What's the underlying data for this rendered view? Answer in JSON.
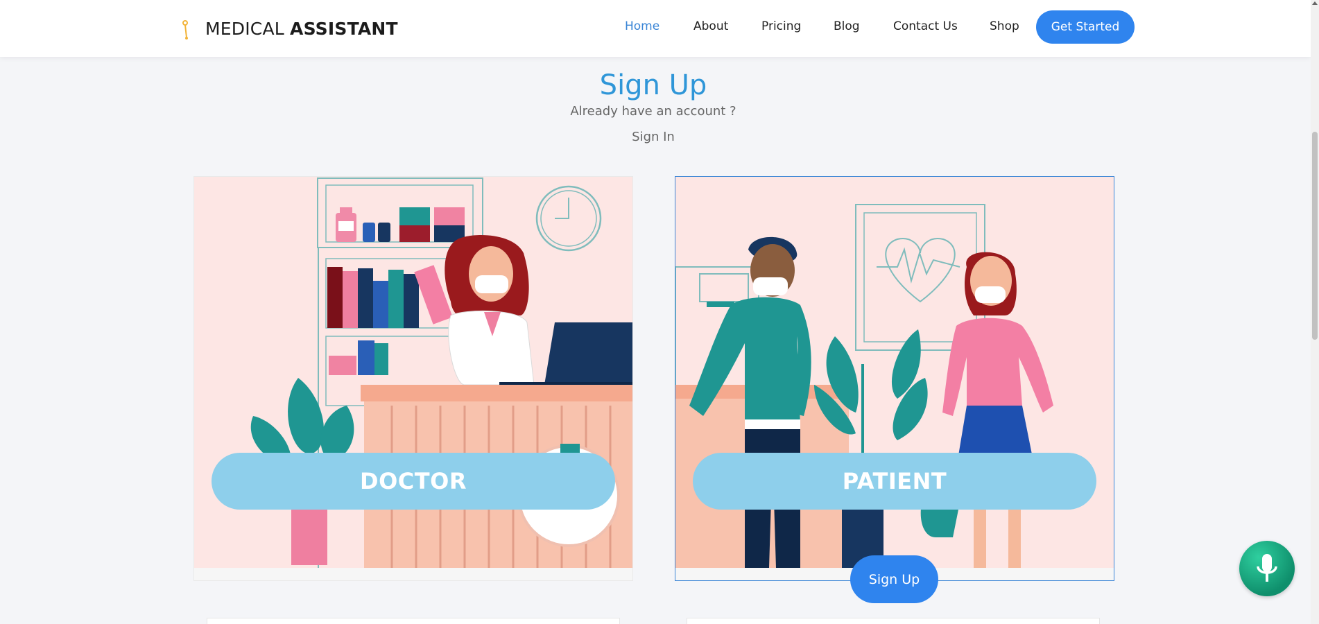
{
  "brand": {
    "name_light": "MEDICAL ",
    "name_bold": "ASSISTANT"
  },
  "nav": {
    "items": [
      {
        "label": "Home",
        "active": true
      },
      {
        "label": "About"
      },
      {
        "label": "Pricing"
      },
      {
        "label": "Blog"
      },
      {
        "label": "Contact Us"
      },
      {
        "label": "Shop"
      }
    ],
    "cta_label": "Get Started"
  },
  "page": {
    "title": "Sign Up",
    "subtitle": "Already have an account ?",
    "signin_label": "Sign In"
  },
  "cards": [
    {
      "role": "DOCTOR",
      "selected": false
    },
    {
      "role": "PATIENT",
      "selected": true
    }
  ],
  "signup_label": "Sign Up",
  "icons": {
    "logo": "stethoscope-icon",
    "mic": "microphone-icon"
  },
  "colors": {
    "accent": "#2f84ee",
    "title": "#2f96d8",
    "role_button": "#8ecfeb",
    "mic": "#14a57c"
  }
}
